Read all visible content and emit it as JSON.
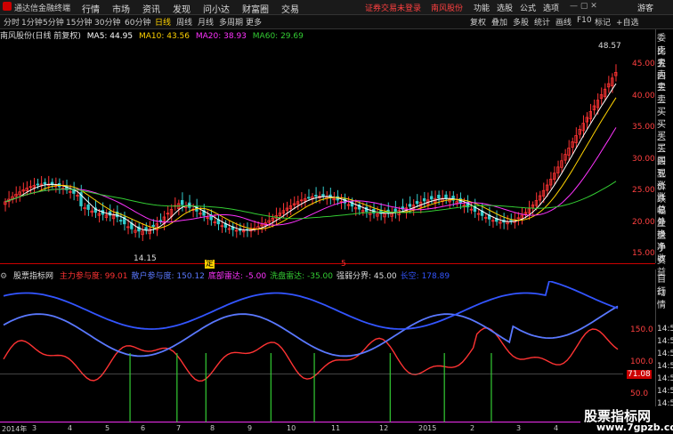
{
  "app": {
    "name": "通达信金融终端"
  },
  "menu": [
    {
      "label": "行情"
    },
    {
      "label": "市场"
    },
    {
      "label": "资讯"
    },
    {
      "label": "发现"
    },
    {
      "label": "问小达"
    },
    {
      "label": "财富圈"
    },
    {
      "label": "交易"
    }
  ],
  "notice": "证券交易未登录",
  "stock_name": "南风股份",
  "top_right": [
    {
      "label": "功能"
    },
    {
      "label": "选股"
    },
    {
      "label": "公式"
    },
    {
      "label": "选项"
    },
    {
      "label": "游客"
    }
  ],
  "toolbar": {
    "periods": [
      "分时",
      "1分钟",
      "5分钟",
      "15分钟",
      "30分钟",
      "60分钟",
      "日线",
      "周线",
      "月线",
      "多周期",
      "更多"
    ],
    "active_period": "日线",
    "tools": [
      "复权",
      "叠加",
      "多股",
      "统计",
      "画线",
      "F10",
      "标记",
      "+自选"
    ]
  },
  "ma_legend": {
    "title": "南风股份(日线 前复权)",
    "ma5": "MA5: 44.95",
    "ma10": "MA10: 43.56",
    "ma20": "MA20: 38.93",
    "ma60": "MA60: 29.69"
  },
  "colors": {
    "ma5": "#ffffff",
    "ma10": "#ffd200",
    "ma20": "#ff33ff",
    "ma60": "#33cc33",
    "up": "#ff3333",
    "down": "#33cccc"
  },
  "right_panel": [
    "委比",
    "卖五",
    "卖四",
    "卖三",
    "卖二",
    "卖一",
    "买一",
    "买二",
    "买三",
    "买四",
    "买五",
    "现价",
    "涨跌",
    "涨幅",
    "总量",
    "外盘",
    "换手",
    "净资",
    "收益"
  ],
  "right_panel2": [
    "自动",
    "行情"
  ],
  "price_axis": [
    "45.00",
    "40.00",
    "35.00",
    "30.00",
    "25.00",
    "20.00",
    "15.00"
  ],
  "annotations": {
    "high": "48.57",
    "low": "14.15",
    "mark1": "定",
    "mark2": "5"
  },
  "indicator": {
    "name": "股票指标网",
    "items": [
      {
        "label": "主力参与度:",
        "value": "99.01",
        "color": "#ff3333"
      },
      {
        "label": "散户参与度:",
        "value": "150.12",
        "color": "#5a78ff"
      },
      {
        "label": "底部雷达:",
        "value": "-5.00",
        "color": "#ff33ff"
      },
      {
        "label": "洗盘雷达:",
        "value": "-35.00",
        "color": "#33cc33"
      },
      {
        "label": "强弱分界:",
        "value": "45.00",
        "color": "#dddddd"
      },
      {
        "label": "长空:",
        "value": "178.89",
        "color": "#3355ff"
      }
    ],
    "axis": [
      "150.0",
      "100.0",
      "50.0"
    ],
    "current": "71.08"
  },
  "right_times": [
    "14:56",
    "14:56",
    "14:56",
    "14:56",
    "14:56",
    "14:56",
    "14:56",
    "14:56",
    "14:56"
  ],
  "time_axis": [
    "2014年",
    "3",
    "4",
    "5",
    "6",
    "7",
    "8",
    "9",
    "10",
    "11",
    "12",
    "2015",
    "2",
    "3",
    "4"
  ],
  "badge": {
    "title": "股票指标网",
    "url": "www.7gpzb.com"
  }
}
